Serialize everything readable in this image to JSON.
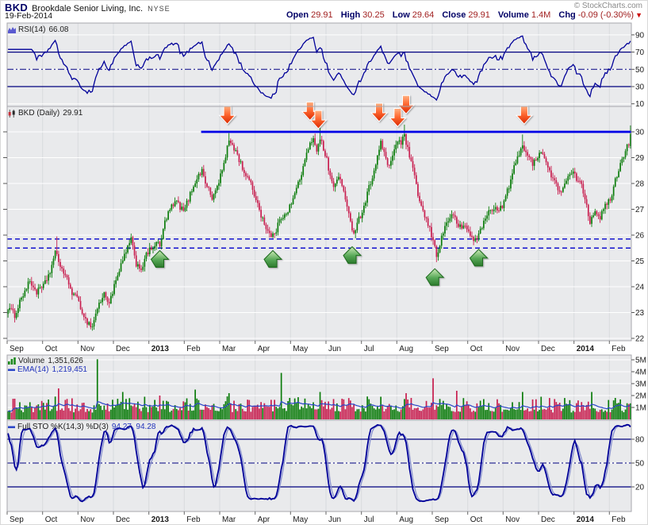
{
  "header": {
    "symbol": "BKD",
    "name": "Brookdale Senior Living, Inc.",
    "exchange": "NYSE",
    "date": "19-Feb-2014",
    "copyright": "© StockCharts.com",
    "quote": {
      "open": {
        "label": "Open",
        "value": "29.91"
      },
      "high": {
        "label": "High",
        "value": "30.25"
      },
      "low": {
        "label": "Low",
        "value": "29.64"
      },
      "close": {
        "label": "Close",
        "value": "29.91"
      },
      "volume": {
        "label": "Volume",
        "value": "1.4M"
      },
      "chg": {
        "label": "Chg",
        "value": "-0.09 (-0.30%)"
      },
      "chg_arrow": "▼"
    }
  },
  "panels": {
    "rsi": {
      "label": "RSI(14)",
      "value": "66.08"
    },
    "price": {
      "label": "BKD (Daily)",
      "value": "29.91"
    },
    "volume": {
      "label": "Volume",
      "value": "1,351,626",
      "ema_label": "EMA(14)",
      "ema_value": "1,219,451"
    },
    "sto": {
      "label": "Full STO %K(14,3) %D(3)",
      "value": "94.27, 94.28"
    }
  },
  "chart_data": {
    "type": "candlestick",
    "symbol": "BKD",
    "period": "Daily",
    "days_total": 370,
    "months": [
      {
        "label": "Sep",
        "day": 0,
        "bold": false
      },
      {
        "label": "Oct",
        "day": 21,
        "bold": false
      },
      {
        "label": "Nov",
        "day": 42,
        "bold": false
      },
      {
        "label": "Dec",
        "day": 63,
        "bold": false
      },
      {
        "label": "2013",
        "day": 84,
        "bold": true
      },
      {
        "label": "Feb",
        "day": 105,
        "bold": false
      },
      {
        "label": "Mar",
        "day": 126,
        "bold": false
      },
      {
        "label": "Apr",
        "day": 147,
        "bold": false
      },
      {
        "label": "May",
        "day": 168,
        "bold": false
      },
      {
        "label": "Jun",
        "day": 189,
        "bold": false
      },
      {
        "label": "Jul",
        "day": 210,
        "bold": false
      },
      {
        "label": "Aug",
        "day": 231,
        "bold": false
      },
      {
        "label": "Sep",
        "day": 252,
        "bold": false
      },
      {
        "label": "Oct",
        "day": 273,
        "bold": false
      },
      {
        "label": "Nov",
        "day": 294,
        "bold": false
      },
      {
        "label": "Dec",
        "day": 315,
        "bold": false
      },
      {
        "label": "2014",
        "day": 336,
        "bold": true
      },
      {
        "label": "Feb",
        "day": 357,
        "bold": false
      }
    ],
    "axes": {
      "price_ticks": [
        30,
        29,
        28,
        27,
        26,
        25,
        24,
        23,
        22
      ],
      "price_range": [
        21.9,
        31.0
      ],
      "rsi_ticks": [
        90,
        70,
        50,
        30,
        10
      ],
      "rsi_bands": {
        "overbought": 70,
        "mid": 50,
        "oversold": 30
      },
      "volume_ticks_millions": [
        5,
        4,
        3,
        2,
        1
      ],
      "sto_ticks": [
        80,
        50,
        20
      ],
      "sto_bands": {
        "overbought": 80,
        "mid": 50,
        "oversold": 20
      }
    },
    "price_anchors": [
      [
        0,
        23.2
      ],
      [
        4,
        22.9
      ],
      [
        8,
        23.6
      ],
      [
        13,
        24.2
      ],
      [
        17,
        23.8
      ],
      [
        21,
        24.0
      ],
      [
        25,
        24.6
      ],
      [
        28,
        25.3
      ],
      [
        30,
        25.0
      ],
      [
        34,
        24.4
      ],
      [
        38,
        23.8
      ],
      [
        42,
        23.4
      ],
      [
        46,
        22.7
      ],
      [
        50,
        22.45
      ],
      [
        53,
        23.2
      ],
      [
        57,
        23.7
      ],
      [
        60,
        23.4
      ],
      [
        63,
        24.0
      ],
      [
        67,
        24.8
      ],
      [
        70,
        25.4
      ],
      [
        73,
        25.8
      ],
      [
        76,
        24.9
      ],
      [
        79,
        24.7
      ],
      [
        82,
        25.2
      ],
      [
        85,
        25.5
      ],
      [
        88,
        25.7
      ],
      [
        90,
        25.55
      ],
      [
        93,
        26.5
      ],
      [
        96,
        27.0
      ],
      [
        100,
        27.3
      ],
      [
        104,
        26.9
      ],
      [
        107,
        27.4
      ],
      [
        111,
        28.1
      ],
      [
        115,
        28.5
      ],
      [
        118,
        27.9
      ],
      [
        121,
        27.4
      ],
      [
        124,
        27.9
      ],
      [
        126,
        28.3
      ],
      [
        129,
        29.0
      ],
      [
        131,
        29.7
      ],
      [
        133,
        29.5
      ],
      [
        136,
        29.1
      ],
      [
        139,
        28.6
      ],
      [
        142,
        28.2
      ],
      [
        145,
        27.8
      ],
      [
        147,
        27.4
      ],
      [
        150,
        26.8
      ],
      [
        153,
        26.3
      ],
      [
        156,
        25.9
      ],
      [
        159,
        26.2
      ],
      [
        162,
        26.7
      ],
      [
        165,
        26.9
      ],
      [
        168,
        27.2
      ],
      [
        171,
        27.8
      ],
      [
        174,
        28.4
      ],
      [
        177,
        29.1
      ],
      [
        179,
        29.5
      ],
      [
        181,
        29.8
      ],
      [
        183,
        29.3
      ],
      [
        185,
        29.8
      ],
      [
        187,
        29.3
      ],
      [
        189,
        28.9
      ],
      [
        191,
        28.3
      ],
      [
        193,
        27.8
      ],
      [
        196,
        28.3
      ],
      [
        198,
        28.0
      ],
      [
        201,
        27.0
      ],
      [
        203,
        26.5
      ],
      [
        205,
        26.1
      ],
      [
        207,
        26.5
      ],
      [
        210,
        26.9
      ],
      [
        213,
        27.6
      ],
      [
        216,
        28.3
      ],
      [
        219,
        29.0
      ],
      [
        221,
        29.6
      ],
      [
        223,
        29.2
      ],
      [
        225,
        28.6
      ],
      [
        227,
        28.9
      ],
      [
        229,
        29.3
      ],
      [
        231,
        29.7
      ],
      [
        233,
        29.5
      ],
      [
        235,
        29.9
      ],
      [
        237,
        29.3
      ],
      [
        239,
        28.8
      ],
      [
        241,
        28.2
      ],
      [
        243,
        27.6
      ],
      [
        245,
        27.1
      ],
      [
        247,
        26.7
      ],
      [
        249,
        26.4
      ],
      [
        252,
        25.8
      ],
      [
        254,
        25.2
      ],
      [
        257,
        25.9
      ],
      [
        260,
        26.5
      ],
      [
        263,
        26.8
      ],
      [
        266,
        26.5
      ],
      [
        269,
        26.2
      ],
      [
        271,
        26.4
      ],
      [
        273,
        26.1
      ],
      [
        276,
        25.8
      ],
      [
        279,
        26.0
      ],
      [
        282,
        26.5
      ],
      [
        285,
        26.9
      ],
      [
        288,
        27.1
      ],
      [
        291,
        26.9
      ],
      [
        294,
        27.3
      ],
      [
        297,
        27.9
      ],
      [
        300,
        28.6
      ],
      [
        303,
        29.2
      ],
      [
        305,
        29.5
      ],
      [
        308,
        29.1
      ],
      [
        311,
        28.7
      ],
      [
        313,
        29.0
      ],
      [
        316,
        29.3
      ],
      [
        319,
        28.8
      ],
      [
        322,
        28.3
      ],
      [
        325,
        27.9
      ],
      [
        328,
        27.7
      ],
      [
        331,
        28.1
      ],
      [
        334,
        28.4
      ],
      [
        336,
        28.3
      ],
      [
        340,
        27.9
      ],
      [
        343,
        27.2
      ],
      [
        345,
        26.5
      ],
      [
        348,
        27.0
      ],
      [
        351,
        26.7
      ],
      [
        354,
        27.1
      ],
      [
        357,
        27.4
      ],
      [
        360,
        28.1
      ],
      [
        363,
        28.8
      ],
      [
        366,
        29.3
      ],
      [
        368,
        29.6
      ],
      [
        369,
        29.91
      ]
    ],
    "wick_overrides": [
      [
        29,
        "high",
        25.95
      ],
      [
        50,
        "low",
        22.3
      ],
      [
        131,
        "high",
        29.95
      ],
      [
        185,
        "high",
        30.15
      ],
      [
        235,
        "high",
        30.28
      ],
      [
        254,
        "low",
        24.95
      ],
      [
        305,
        "high",
        29.9
      ]
    ],
    "last_candle": {
      "open": 29.45,
      "high": 30.25,
      "low": 29.35,
      "close": 29.91
    },
    "resistance": {
      "price": 30.0,
      "from_day": 115,
      "to_day": 370
    },
    "support_dashed": [
      25.85,
      25.5
    ],
    "arrows_red": [
      {
        "day": 130,
        "tip": 30.3
      },
      {
        "day": 179,
        "tip": 30.45
      },
      {
        "day": 184,
        "tip": 30.12
      },
      {
        "day": 220,
        "tip": 30.4
      },
      {
        "day": 231,
        "tip": 30.2
      },
      {
        "day": 236,
        "tip": 30.7
      },
      {
        "day": 306,
        "tip": 30.3
      }
    ],
    "arrows_green": [
      {
        "day": 90,
        "tip": 25.4
      },
      {
        "day": 157,
        "tip": 25.4
      },
      {
        "day": 204,
        "tip": 25.55
      },
      {
        "day": 253,
        "tip": 24.7
      },
      {
        "day": 279,
        "tip": 25.45
      }
    ],
    "volume_spikes_millions": [
      [
        30,
        2.6
      ],
      [
        53,
        5.05
      ],
      [
        68,
        2.3
      ],
      [
        90,
        2.0
      ],
      [
        111,
        2.5
      ],
      [
        131,
        2.2
      ],
      [
        162,
        3.9
      ],
      [
        185,
        2.3
      ],
      [
        221,
        1.9
      ],
      [
        236,
        2.2
      ],
      [
        252,
        3.45
      ],
      [
        266,
        2.4
      ],
      [
        305,
        2.3
      ],
      [
        316,
        1.9
      ],
      [
        346,
        2.3
      ],
      [
        360,
        1.8
      ],
      [
        369,
        1.35
      ]
    ],
    "colors": {
      "up": "#0b7c0b",
      "down": "#c81e4f",
      "resistance": "#0000e6",
      "support": "#0000cc",
      "rsi_line": "#000099",
      "sto_k": "#000099",
      "sto_d": "#8a93cf",
      "ema": "#2b46c8",
      "navy_band": "#000080",
      "grid_h": "#ffffff",
      "grid_v": "#d8dade",
      "panel_bg": "#e9eaec",
      "panel_border": "#a7a7ad",
      "tick": "#555555",
      "axis_text": "#1a1a1a",
      "arrow_red_light": "#ffb080",
      "arrow_red_dark": "#d92800",
      "arrow_green_light": "#cdeab8",
      "arrow_green_dark": "#2c7a2c"
    }
  }
}
